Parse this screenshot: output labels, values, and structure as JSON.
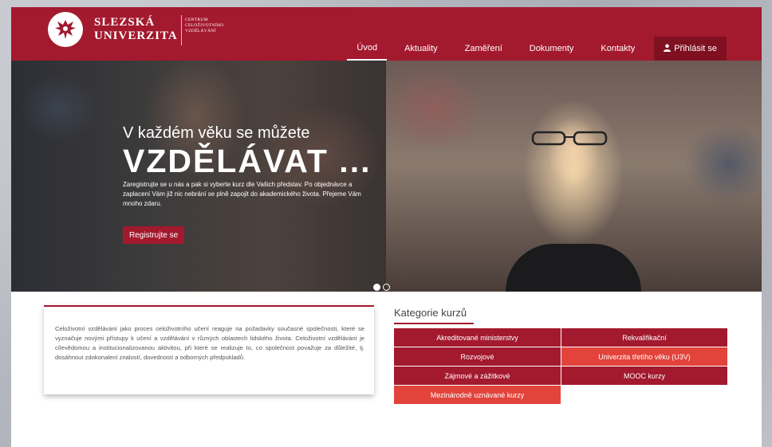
{
  "header": {
    "logo_line1": "SLEZSKÁ",
    "logo_line2": "UNIVERZITA",
    "logo_sub1": "CENTRUM",
    "logo_sub2": "CELOŽIVOTNÍHO",
    "logo_sub3": "VZDĚLÁVÁNÍ",
    "nav": {
      "uvod": "Úvod",
      "aktuality": "Aktuality",
      "zamereni": "Zaměření",
      "dokumenty": "Dokumenty",
      "kontakty": "Kontakty",
      "login": "Přihlásit se"
    }
  },
  "hero": {
    "title_small": "V každém věku se můžete",
    "title_big": "VZDĚLÁVAT ...",
    "description": "Zaregistrujte se u nás a pak si vyberte kurz dle Vašich představ. Po objednávce a zaplacení Vám již nic nebrání se plně zapojit do akademického života. Přejeme Vám mnoho zdaru.",
    "button": "Registrujte se"
  },
  "info": {
    "text": "Celoživotní vzdělávání jako proces celoživotního učení reaguje na požadavky současné společnosti, které se vyznačuje novými přístupy k učení a vzdělávání v různých oblastech lidského života. Celoživotní vzdělávání je cílevědomou a institucionalizovanou aktivitou, při které se realizuje to, co společnost považuje za důležité, tj. dosáhnout zdokonalení znalostí, dovedností a odborných předpokladů."
  },
  "categories": {
    "title": "Kategorie kurzů",
    "items": [
      "Akreditované ministerstvy",
      "Rekvalifikační",
      "Rozvojové",
      "Univerzita třetího věku (U3V)",
      "Zájmové a zážitkové",
      "MOOC kurzy",
      "Mezinárodně uznávané kurzy"
    ]
  },
  "colors": {
    "brand": "#a3192e",
    "accent": "#e2433b"
  }
}
